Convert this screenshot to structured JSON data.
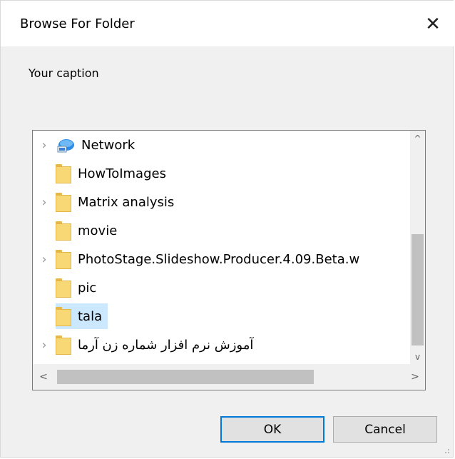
{
  "dialog": {
    "title": "Browse For Folder",
    "close_symbol": "✕",
    "caption": "Your caption"
  },
  "tree": {
    "items": [
      {
        "label": "Network",
        "icon": "network-icon",
        "expandable": true,
        "selected": false
      },
      {
        "label": "HowToImages",
        "icon": "folder-icon",
        "expandable": false,
        "selected": false
      },
      {
        "label": "Matrix analysis",
        "icon": "folder-icon",
        "expandable": true,
        "selected": false
      },
      {
        "label": "movie",
        "icon": "folder-icon",
        "expandable": false,
        "selected": false
      },
      {
        "label": "PhotoStage.Slideshow.Producer.4.09.Beta.w",
        "icon": "folder-icon",
        "expandable": true,
        "selected": false
      },
      {
        "label": "pic",
        "icon": "folder-icon",
        "expandable": false,
        "selected": false
      },
      {
        "label": "tala",
        "icon": "folder-icon",
        "expandable": false,
        "selected": true
      },
      {
        "label": "آموزش نرم افزار شماره زن آرما",
        "icon": "folder-icon",
        "expandable": true,
        "selected": false
      }
    ]
  },
  "scroll": {
    "up_symbol": "^",
    "down_symbol": "v",
    "left_symbol": "<",
    "right_symbol": ">"
  },
  "buttons": {
    "ok_label": "OK",
    "cancel_label": "Cancel"
  },
  "colors": {
    "selection": "#cce8ff",
    "ok_border": "#0078d7",
    "folder": "#f8d775"
  }
}
